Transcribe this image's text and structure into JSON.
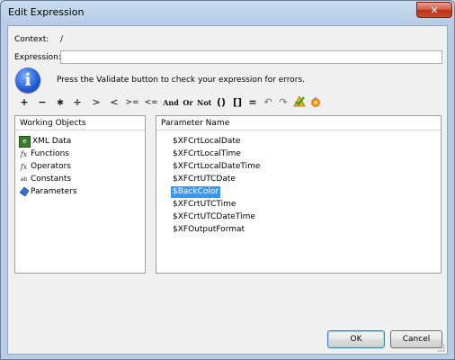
{
  "window": {
    "title": "Edit Expression",
    "close_glyph": "✕"
  },
  "context": {
    "label": "Context:",
    "value": "/"
  },
  "expression": {
    "label": "Expression:",
    "value": ""
  },
  "info": {
    "icon_glyph": "i",
    "text": "Press the Validate button to check your expression for errors."
  },
  "toolbar": {
    "plus": "+",
    "minus": "−",
    "multiply": "∗",
    "divide": "÷",
    "gt": ">",
    "lt": "<",
    "ge": ">=",
    "le": "<=",
    "and": "And",
    "or": "Or",
    "not": "Not",
    "parens": "()",
    "brackets": "[]",
    "equals": "=",
    "undo_glyph": "↶",
    "redo_glyph": "↷"
  },
  "working_objects": {
    "header": "Working Objects",
    "items": [
      {
        "label": "XML Data",
        "icon": "xml-data-icon"
      },
      {
        "label": "Functions",
        "icon": "function-icon"
      },
      {
        "label": "Operators",
        "icon": "operator-icon"
      },
      {
        "label": "Constants",
        "icon": "constant-icon"
      },
      {
        "label": "Parameters",
        "icon": "parameter-icon"
      }
    ]
  },
  "parameters": {
    "header": "Parameter Name",
    "items": [
      "$XFCrtLocalDate",
      "$XFCrtLocalTime",
      "$XFCrtLocalDateTime",
      "$XFCrtUTCDate",
      "$BackColor",
      "$XFCrtUTCTime",
      "$XFCrtUTCDateTime",
      "$XFOutputFormat"
    ],
    "selected": "$BackColor"
  },
  "buttons": {
    "ok": "OK",
    "cancel": "Cancel"
  },
  "colors": {
    "selection": "#3399ff",
    "titlebar": "#b7cde6",
    "close": "#c94b2d"
  }
}
